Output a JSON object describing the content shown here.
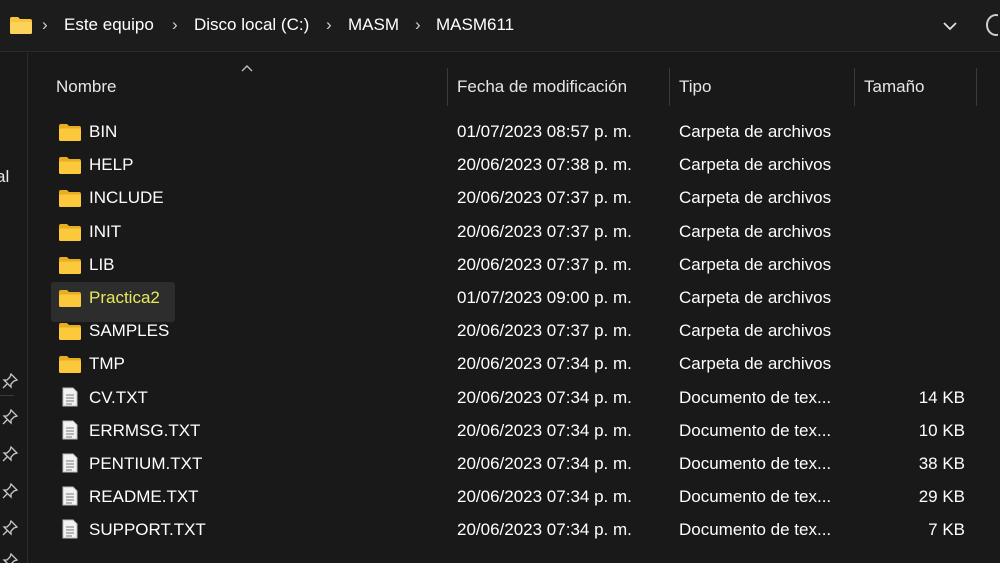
{
  "address_bar": {
    "breadcrumbs": [
      "Este equipo",
      "Disco local (C:)",
      "MASM",
      "MASM611"
    ],
    "separator": "›"
  },
  "nav_pane": {
    "cut_label": "al"
  },
  "columns": {
    "name": "Nombre",
    "date": "Fecha de modificación",
    "type": "Tipo",
    "size": "Tamaño"
  },
  "files": [
    {
      "name": "BIN",
      "date": "01/07/2023 08:57 p. m.",
      "type": "Carpeta de archivos",
      "size": "",
      "icon": "folder-icon"
    },
    {
      "name": "HELP",
      "date": "20/06/2023 07:38 p. m.",
      "type": "Carpeta de archivos",
      "size": "",
      "icon": "folder-icon"
    },
    {
      "name": "INCLUDE",
      "date": "20/06/2023 07:37 p. m.",
      "type": "Carpeta de archivos",
      "size": "",
      "icon": "folder-icon"
    },
    {
      "name": "INIT",
      "date": "20/06/2023 07:37 p. m.",
      "type": "Carpeta de archivos",
      "size": "",
      "icon": "folder-icon"
    },
    {
      "name": "LIB",
      "date": "20/06/2023 07:37 p. m.",
      "type": "Carpeta de archivos",
      "size": "",
      "icon": "folder-icon"
    },
    {
      "name": "Practica2",
      "date": "01/07/2023 09:00 p. m.",
      "type": "Carpeta de archivos",
      "size": "",
      "icon": "folder-icon"
    },
    {
      "name": "SAMPLES",
      "date": "20/06/2023 07:37 p. m.",
      "type": "Carpeta de archivos",
      "size": "",
      "icon": "folder-icon"
    },
    {
      "name": "TMP",
      "date": "20/06/2023 07:34 p. m.",
      "type": "Carpeta de archivos",
      "size": "",
      "icon": "folder-icon"
    },
    {
      "name": "CV.TXT",
      "date": "20/06/2023 07:34 p. m.",
      "type": "Documento de tex...",
      "size": "14 KB",
      "icon": "text-file-icon"
    },
    {
      "name": "ERRMSG.TXT",
      "date": "20/06/2023 07:34 p. m.",
      "type": "Documento de tex...",
      "size": "10 KB",
      "icon": "text-file-icon"
    },
    {
      "name": "PENTIUM.TXT",
      "date": "20/06/2023 07:34 p. m.",
      "type": "Documento de tex...",
      "size": "38 KB",
      "icon": "text-file-icon"
    },
    {
      "name": "README.TXT",
      "date": "20/06/2023 07:34 p. m.",
      "type": "Documento de tex...",
      "size": "29 KB",
      "icon": "text-file-icon"
    },
    {
      "name": "SUPPORT.TXT",
      "date": "20/06/2023 07:34 p. m.",
      "type": "Documento de tex...",
      "size": "7 KB",
      "icon": "text-file-icon"
    }
  ],
  "colors": {
    "background": "#191919",
    "folder": "#f8c43a",
    "hover_text": "#e7e95b",
    "text": "#ffffff"
  }
}
